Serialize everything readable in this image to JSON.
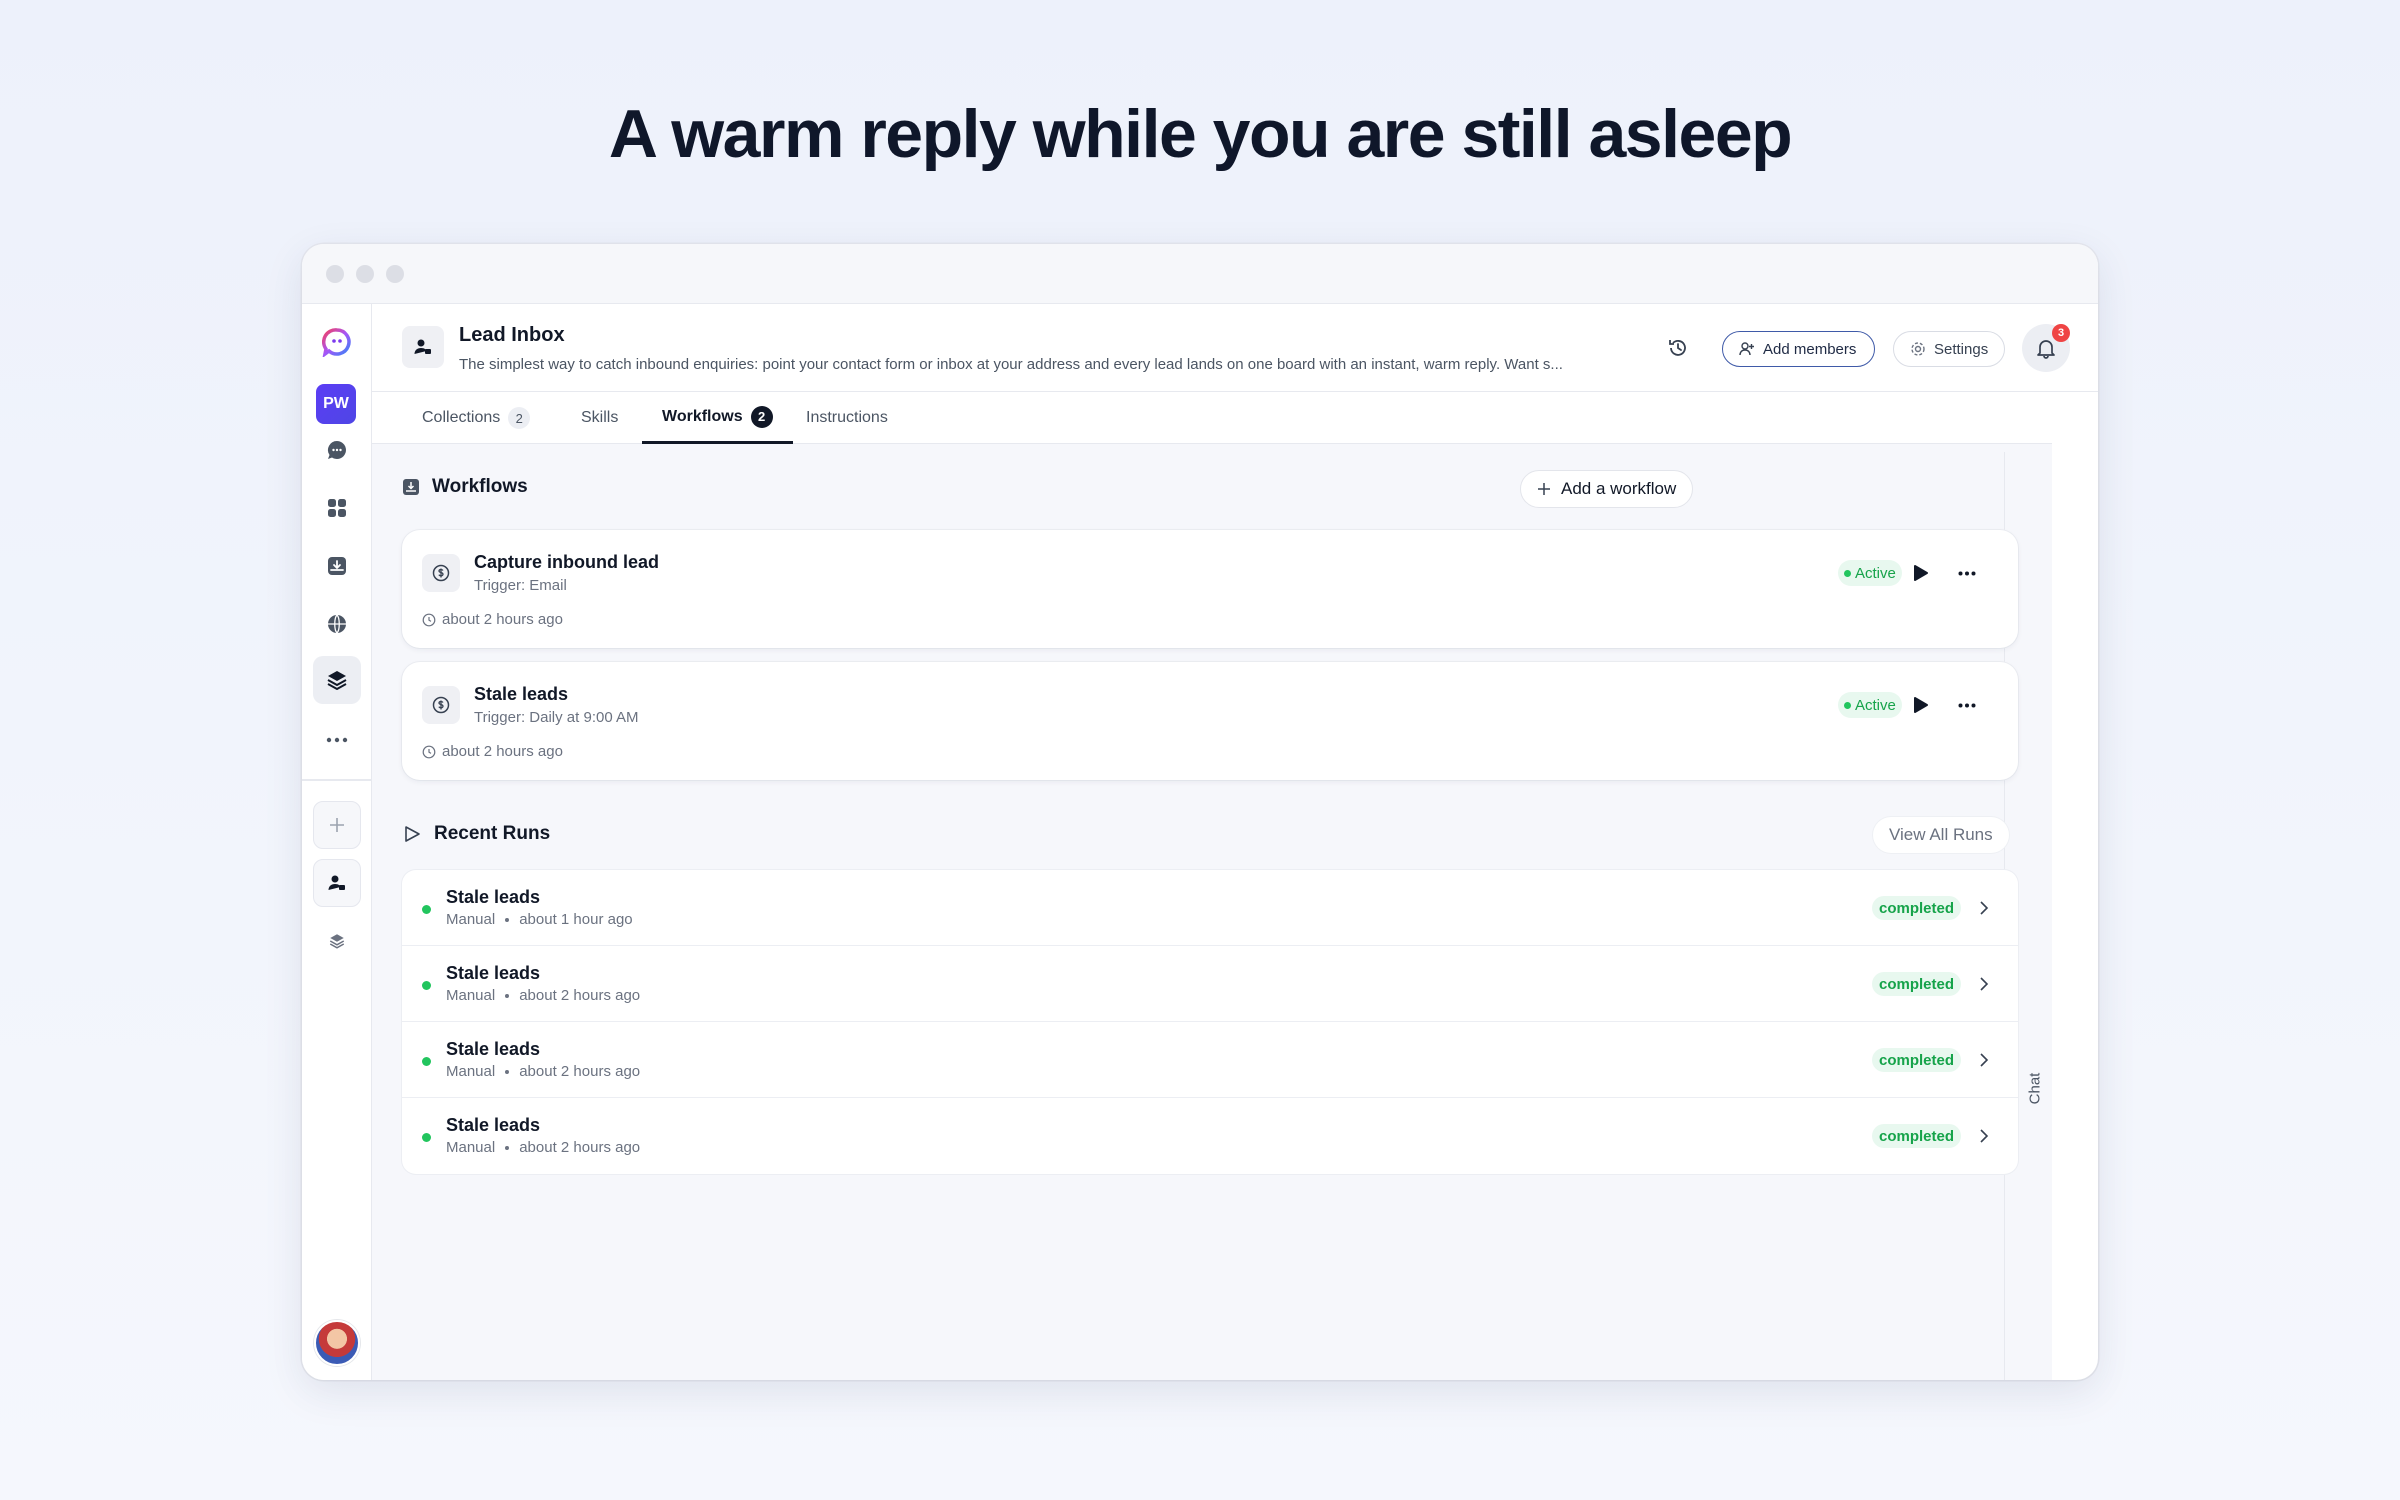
{
  "headline": "A warm reply while you are still asleep",
  "sidebar": {
    "workspace_initials": "PW",
    "items": [
      "logo-icon",
      "chat-icon",
      "grid-icon",
      "inbox-icon",
      "globe-icon",
      "layers-icon",
      "more-icon"
    ]
  },
  "header": {
    "title": "Lead Inbox",
    "description": "The simplest way to catch inbound enquiries: point your contact form or inbox at your address and every lead lands on one board with an instant, warm reply. Want s...",
    "add_members_label": "Add members",
    "settings_label": "Settings",
    "notification_count": "3"
  },
  "tabs": [
    {
      "label": "Collections",
      "count": "2"
    },
    {
      "label": "Skills",
      "count": ""
    },
    {
      "label": "Workflows",
      "count": "2"
    },
    {
      "label": "Instructions",
      "count": ""
    }
  ],
  "workflows": {
    "title": "Workflows",
    "add_label": "Add a workflow",
    "items": [
      {
        "name": "Capture inbound lead",
        "trigger": "Trigger: Email",
        "time": "about 2 hours ago",
        "status": "Active"
      },
      {
        "name": "Stale leads",
        "trigger": "Trigger: Daily at 9:00 AM",
        "time": "about 2 hours ago",
        "status": "Active"
      }
    ]
  },
  "recent_runs": {
    "title": "Recent Runs",
    "view_all_label": "View All Runs",
    "items": [
      {
        "name": "Stale leads",
        "mode": "Manual",
        "time": "about 1 hour ago",
        "status": "completed"
      },
      {
        "name": "Stale leads",
        "mode": "Manual",
        "time": "about 2 hours ago",
        "status": "completed"
      },
      {
        "name": "Stale leads",
        "mode": "Manual",
        "time": "about 2 hours ago",
        "status": "completed"
      },
      {
        "name": "Stale leads",
        "mode": "Manual",
        "time": "about 2 hours ago",
        "status": "completed"
      }
    ]
  },
  "chat_panel_label": "Chat",
  "colors": {
    "accent": "#4f46e5",
    "success": "#16a34a",
    "badge": "#ef4444"
  }
}
